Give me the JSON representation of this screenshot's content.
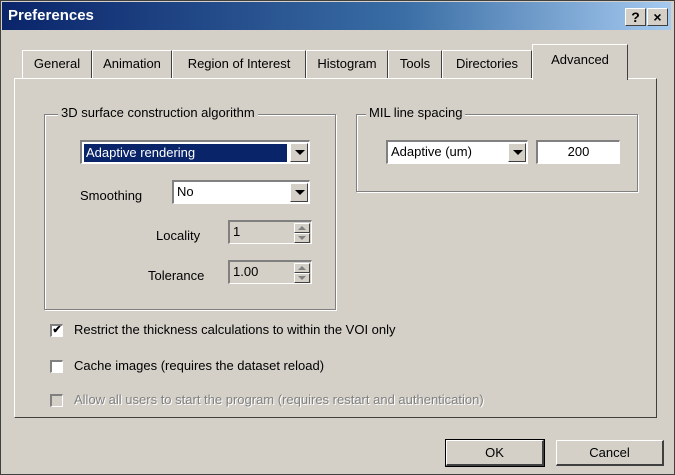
{
  "window": {
    "title": "Preferences",
    "help_label": "?",
    "close_label": "×"
  },
  "tabs": [
    {
      "label": "General"
    },
    {
      "label": "Animation"
    },
    {
      "label": "Region of Interest"
    },
    {
      "label": "Histogram"
    },
    {
      "label": "Tools"
    },
    {
      "label": "Directories"
    },
    {
      "label": "Advanced",
      "active": true
    }
  ],
  "surface_group": {
    "title": "3D surface construction algorithm",
    "algorithm_value": "Adaptive rendering",
    "smoothing_label": "Smoothing",
    "smoothing_value": "No",
    "locality_label": "Locality",
    "locality_value": "1",
    "tolerance_label": "Tolerance",
    "tolerance_value": "1.00"
  },
  "mil_group": {
    "title": "MIL line spacing",
    "mode_value": "Adaptive (um)",
    "spacing_value": "200"
  },
  "options": {
    "restrict_label": "Restrict the thickness calculations to within the VOI only",
    "restrict_checked": true,
    "cache_label": "Cache images (requires the dataset reload)",
    "cache_checked": false,
    "allow_label": "Allow all users to start the program (requires restart and authentication)",
    "allow_checked": false,
    "check_mark": "✔"
  },
  "buttons": {
    "ok": "OK",
    "cancel": "Cancel"
  }
}
